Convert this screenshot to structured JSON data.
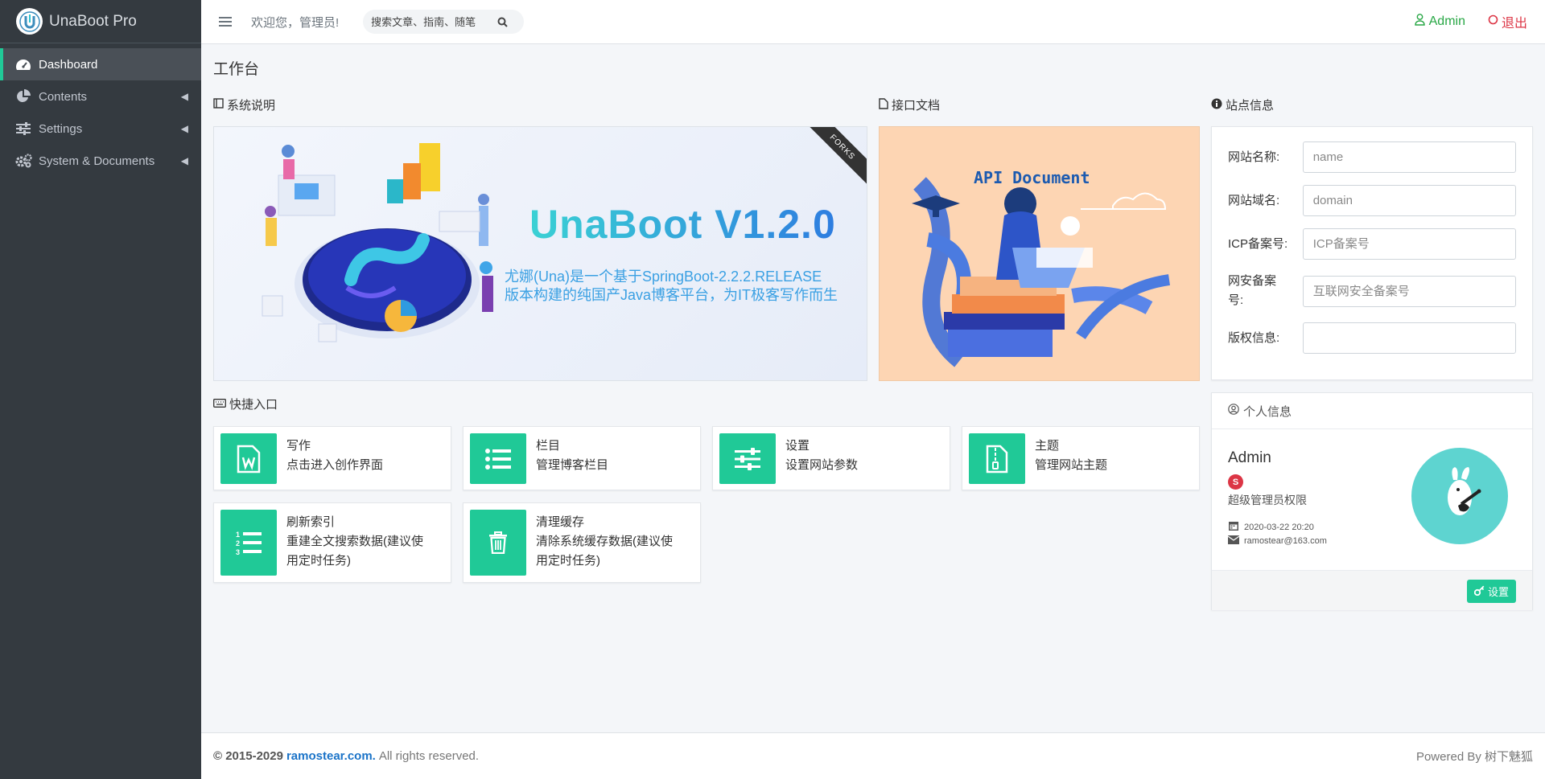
{
  "app": {
    "name": "UnaBoot Pro"
  },
  "sidebar": {
    "items": [
      {
        "label": "Dashboard",
        "icon": "tachometer-icon",
        "active": true
      },
      {
        "label": "Contents",
        "icon": "pie-chart-icon"
      },
      {
        "label": "Settings",
        "icon": "sliders-icon"
      },
      {
        "label": "System & Documents",
        "icon": "cogs-icon"
      }
    ]
  },
  "header": {
    "welcome": "欢迎您，管理员!",
    "search_placeholder": "搜索文章、指南、随笔",
    "admin_label": "Admin",
    "logout_label": "退出"
  },
  "page": {
    "title": "工作台"
  },
  "sections": {
    "system": "系统说明",
    "api": "接口文档",
    "site": "站点信息",
    "quick": "快捷入口"
  },
  "banner": {
    "title": "UnaBoot V1.2.0",
    "line1": "尤娜(Una)是一个基于SpringBoot-2.2.2.RELEASE",
    "line2": "版本构建的纯国产Java博客平台，为IT极客写作而生",
    "ribbon": "FORKS"
  },
  "api_doc": {
    "title": "API Document"
  },
  "site_info": {
    "fields": [
      {
        "label": "网站名称:",
        "placeholder": "name",
        "value": ""
      },
      {
        "label": "网站域名:",
        "placeholder": "domain",
        "value": ""
      },
      {
        "label": "ICP备案号:",
        "placeholder": "ICP备案号",
        "value": ""
      },
      {
        "label": "网安备案号:",
        "placeholder": "互联网安全备案号",
        "value": ""
      },
      {
        "label": "版权信息:",
        "placeholder": "",
        "value": ""
      }
    ]
  },
  "quick": [
    {
      "title": "写作",
      "desc": "点击进入创作界面",
      "icon": "file-word-icon"
    },
    {
      "title": "栏目",
      "desc": "管理博客栏目",
      "icon": "list-icon"
    },
    {
      "title": "设置",
      "desc": "设置网站参数",
      "icon": "sliders-icon"
    },
    {
      "title": "主题",
      "desc": "管理网站主题",
      "icon": "file-zip-icon"
    },
    {
      "title": "刷新索引",
      "desc": "重建全文搜索数据(建议使用定时任务)",
      "icon": "list-ol-icon"
    },
    {
      "title": "清理缓存",
      "desc": "清除系统缓存数据(建议使用定时任务)",
      "icon": "trash-icon"
    }
  ],
  "profile": {
    "heading": "个人信息",
    "name": "Admin",
    "badge": "S",
    "role": "超级管理员权限",
    "date": "2020-03-22 20:20",
    "email": "ramostear@163.com",
    "settings_label": "设置"
  },
  "footer": {
    "copyright": "© 2015-2029",
    "site": "ramostear.com.",
    "rights": "All rights reserved.",
    "powered": "Powered By 树下魅狐"
  },
  "colors": {
    "accent": "#20c997",
    "sidebar": "#343a40",
    "link": "#28a745",
    "danger": "#dc3545"
  }
}
